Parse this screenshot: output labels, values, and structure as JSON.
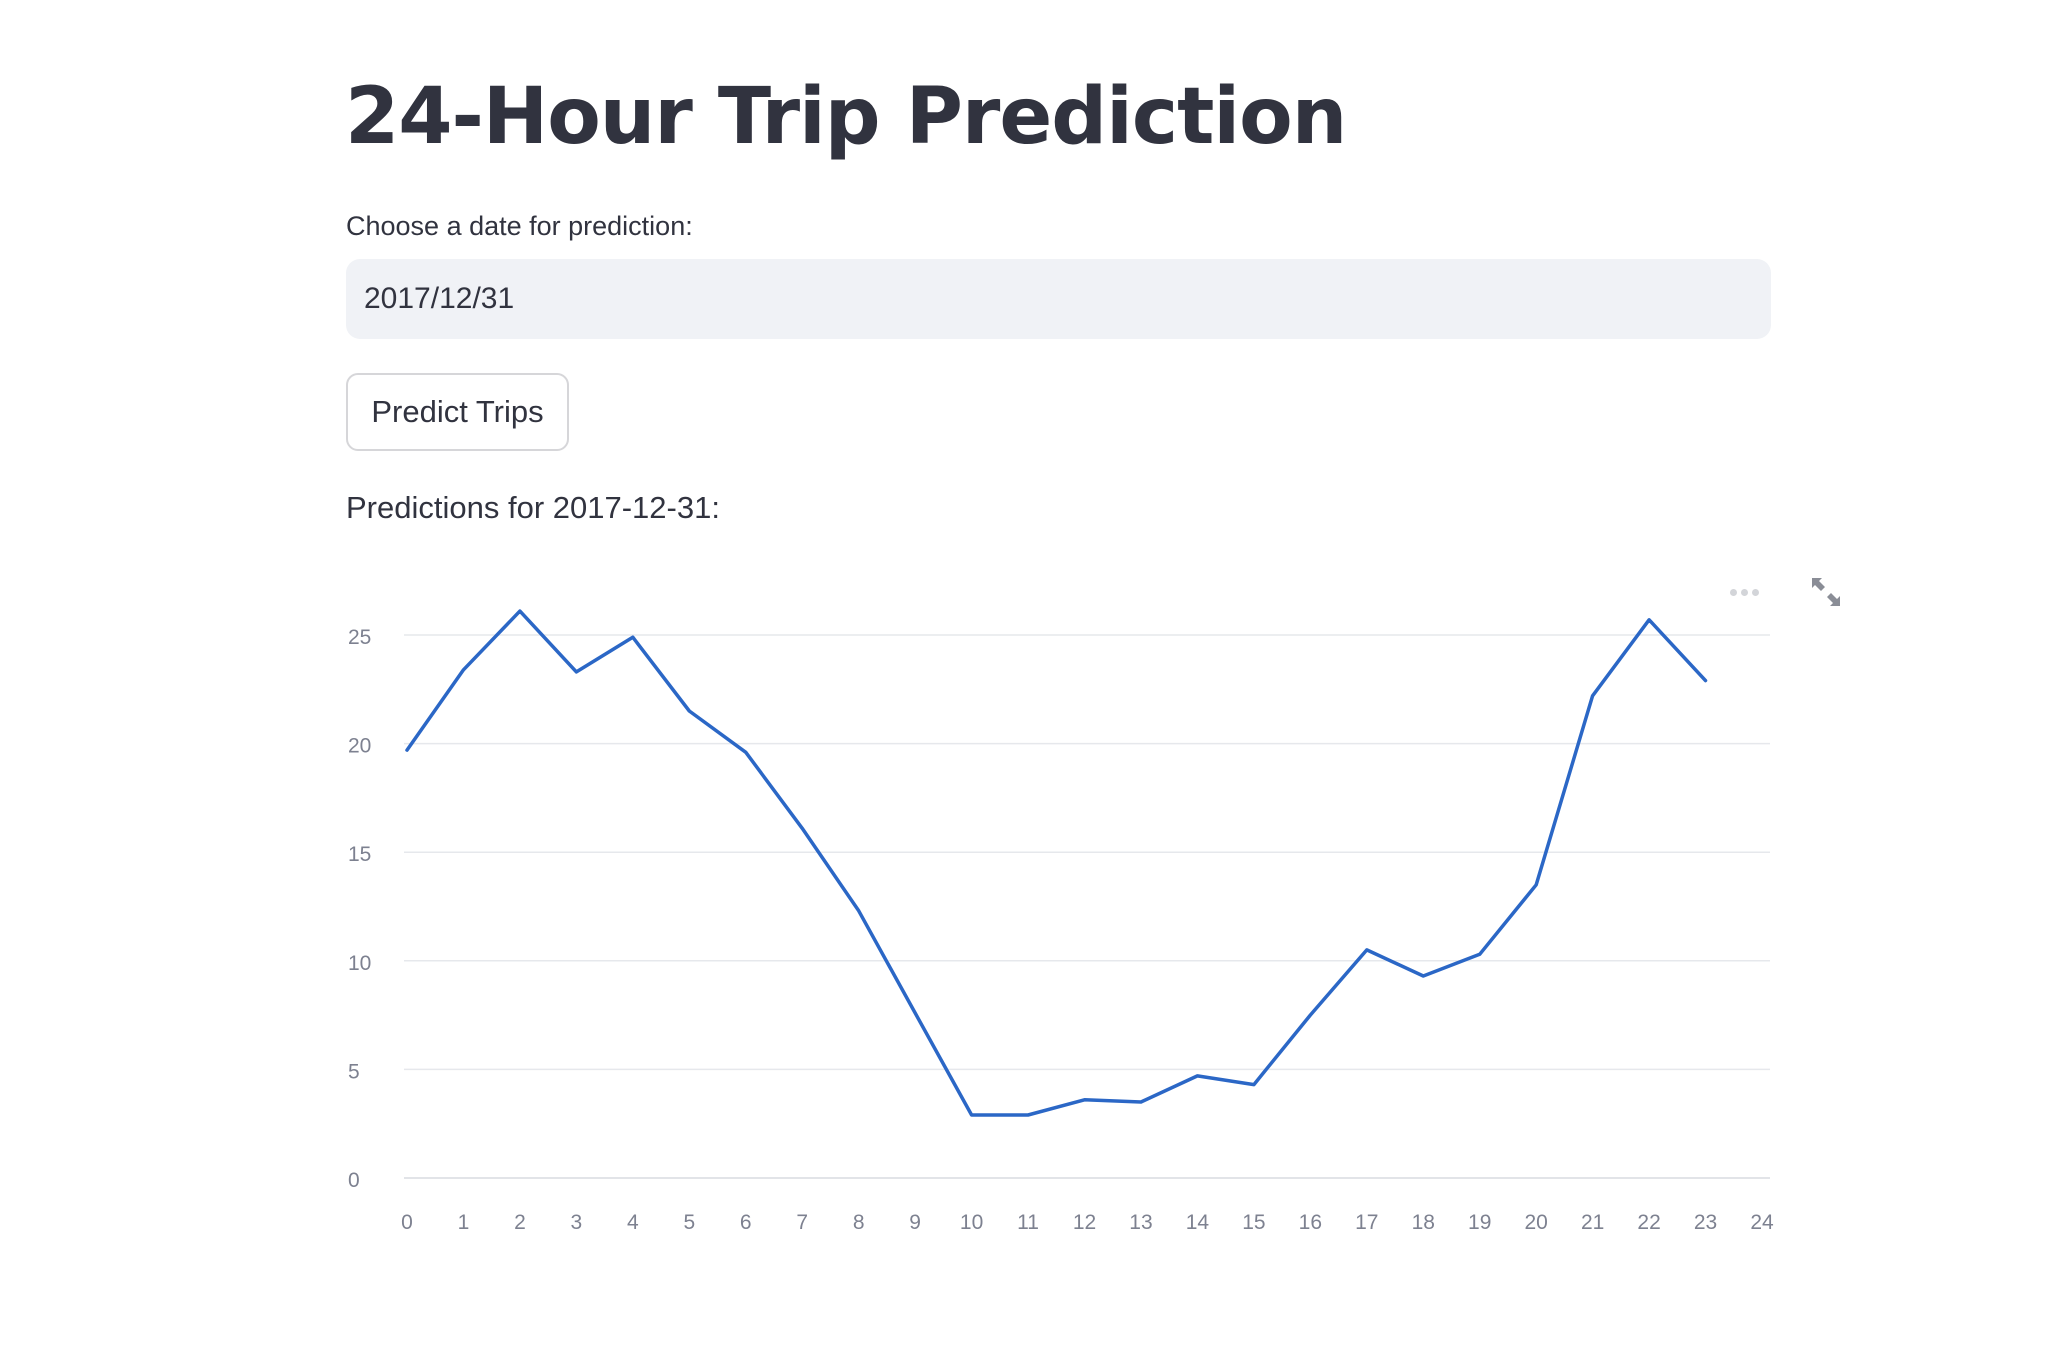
{
  "page": {
    "title": "24-Hour Trip Prediction"
  },
  "date_input": {
    "label": "Choose a date for prediction:",
    "value": "2017/12/31"
  },
  "predict_button": {
    "label": "Predict Trips"
  },
  "results": {
    "heading": "Predictions for 2017-12-31:"
  },
  "chart_toolbar": {
    "more_icon": "more-horizontal-icon",
    "expand_icon": "expand-icon"
  },
  "colors": {
    "line": "#2b67c6",
    "grid": "#e6e8ec",
    "tick_text": "#7d8190",
    "text": "#31333f",
    "input_bg": "#f0f2f6"
  },
  "chart_data": {
    "type": "line",
    "title": "",
    "xlabel": "",
    "ylabel": "",
    "x": [
      0,
      1,
      2,
      3,
      4,
      5,
      6,
      7,
      8,
      9,
      10,
      11,
      12,
      13,
      14,
      15,
      16,
      17,
      18,
      19,
      20,
      21,
      22,
      23
    ],
    "y": [
      19.7,
      23.4,
      26.1,
      23.3,
      24.9,
      21.5,
      19.6,
      16.1,
      12.3,
      7.6,
      2.9,
      2.9,
      3.6,
      3.5,
      4.7,
      4.3,
      7.5,
      10.5,
      9.3,
      10.3,
      13.5,
      22.2,
      25.7,
      22.9
    ],
    "xlim": [
      0,
      24
    ],
    "ylim": [
      0,
      27
    ],
    "x_ticks": [
      "0",
      "1",
      "2",
      "3",
      "4",
      "5",
      "6",
      "7",
      "8",
      "9",
      "10",
      "11",
      "12",
      "13",
      "14",
      "15",
      "16",
      "17",
      "18",
      "19",
      "20",
      "21",
      "22",
      "23",
      "24"
    ],
    "y_ticks": [
      "0",
      "5",
      "10",
      "15",
      "20",
      "25"
    ],
    "grid": true,
    "legend": "none"
  }
}
